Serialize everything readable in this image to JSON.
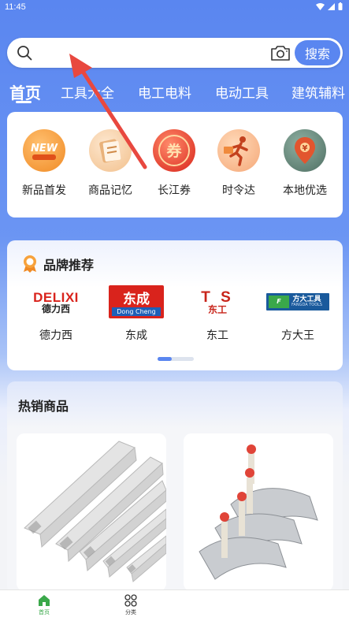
{
  "status_bar": {
    "time": "11:45"
  },
  "search": {
    "placeholder": "",
    "button_label": "搜索"
  },
  "tabs": [
    {
      "label": "首页",
      "active": true
    },
    {
      "label": "工具大全"
    },
    {
      "label": "电工电料"
    },
    {
      "label": "电动工具"
    },
    {
      "label": "建筑辅料"
    }
  ],
  "quick_links": [
    {
      "label": "新品首发",
      "icon": "new-icon"
    },
    {
      "label": "商品记忆",
      "icon": "memo-icon"
    },
    {
      "label": "长江券",
      "icon": "coupon-icon"
    },
    {
      "label": "时令达",
      "icon": "runner-icon"
    },
    {
      "label": "本地优选",
      "icon": "local-icon"
    }
  ],
  "brands": {
    "title": "品牌推荐",
    "items": [
      {
        "name": "德力西",
        "logo_text": "DELIXI",
        "logo_sub": "德力西"
      },
      {
        "name": "东成",
        "logo_text": "东成",
        "logo_sub": "Dong Cheng"
      },
      {
        "name": "东工",
        "logo_text": "T S",
        "logo_sub": "东工"
      },
      {
        "name": "方大王",
        "logo_text": "方大工具",
        "logo_sub": "FANGDA TOOLS"
      }
    ]
  },
  "hot": {
    "title": "热销商品"
  },
  "bottom_nav": [
    {
      "label": "首页",
      "active": true
    },
    {
      "label": "分类"
    }
  ],
  "colors": {
    "accent": "#5a86f0",
    "annotation": "#e8483f"
  }
}
